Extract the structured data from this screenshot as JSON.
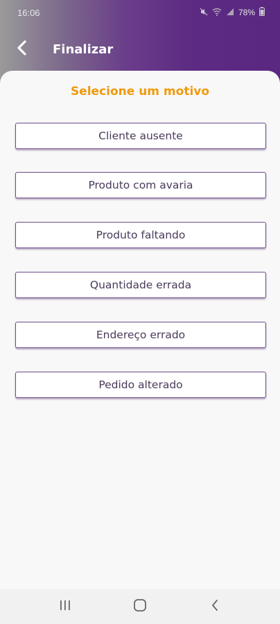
{
  "status_bar": {
    "time": "16:06",
    "battery": "78%",
    "icons": [
      "mute-icon",
      "wifi-icon",
      "signal-icon",
      "battery-icon"
    ]
  },
  "app_bar": {
    "title": "Finalizar",
    "back_icon": "chevron-left-icon"
  },
  "sheet": {
    "title": "Selecione um motivo",
    "reasons": [
      "Cliente ausente",
      "Produto com avaria",
      "Produto faltando",
      "Quantidade errada",
      "Endereço errado",
      "Pedido alterado"
    ]
  },
  "nav_bar": {
    "icons": [
      "recent-apps-icon",
      "home-icon",
      "back-icon"
    ]
  },
  "colors": {
    "brand": "#5c2a82",
    "accent": "#ef9a0e",
    "button_border": "#6c4a8a"
  }
}
